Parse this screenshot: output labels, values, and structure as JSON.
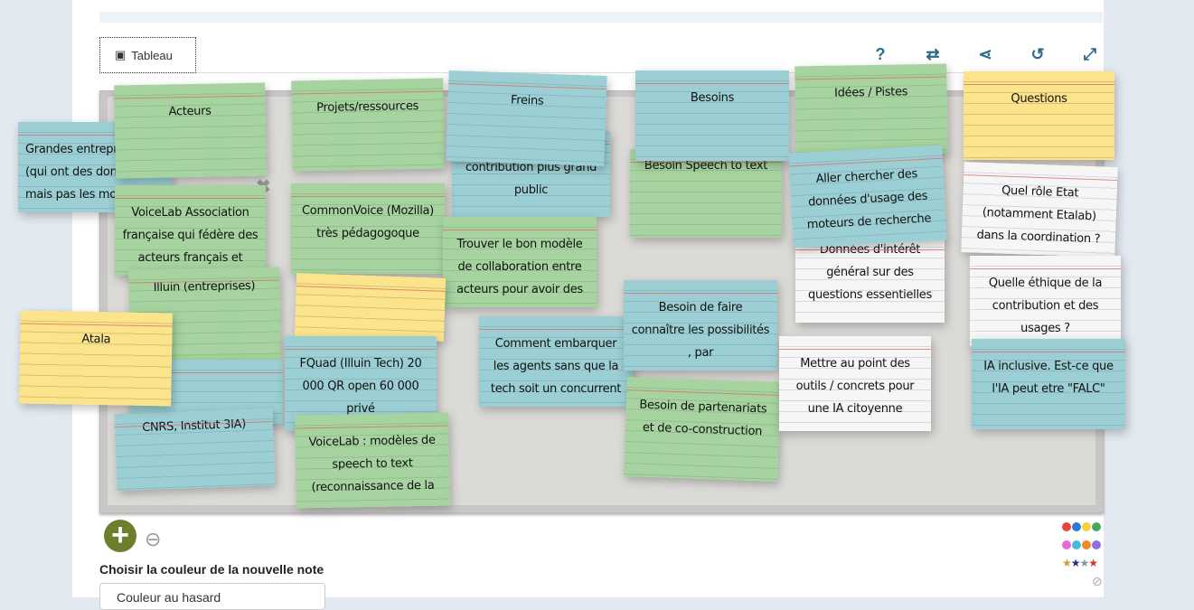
{
  "tab": {
    "label": "Tableau"
  },
  "toolbar": {
    "help": "?",
    "swap": "⇄",
    "share": "⋖",
    "history": "↺",
    "fullscreen": "⤢"
  },
  "notes": [
    {
      "text": "Grandes entreprises (qui ont des données mais pas les moyens)",
      "color": "blue"
    },
    {
      "text": "Acteurs",
      "color": "green"
    },
    {
      "text": "Projets/ressources",
      "color": "green"
    },
    {
      "text": "contribution plus grand public",
      "color": "blue"
    },
    {
      "text": "Freins",
      "color": "blue"
    },
    {
      "text": "Besoin Speech to text",
      "color": "green"
    },
    {
      "text": "Besoins",
      "color": "blue"
    },
    {
      "text": "Idées / Pistes",
      "color": "green"
    },
    {
      "text": "Questions",
      "color": "yellow"
    },
    {
      "text": "VoiceLab Association française qui fédère des acteurs français et",
      "color": "green"
    },
    {
      "text": "CommonVoice (Mozilla) très pédagogoque",
      "color": "green"
    },
    {
      "text": "Trouver le bon modèle de collaboration entre acteurs pour avoir des",
      "color": "green"
    },
    {
      "text": "Illuin (entreprises)",
      "color": "green"
    },
    {
      "text": "",
      "color": "yellow"
    },
    {
      "text": "",
      "color": "blue"
    },
    {
      "text": "CNRS, Institut 3IA)",
      "color": "blue"
    },
    {
      "text": "Atala",
      "color": "yellow"
    },
    {
      "text": "FQuad (Illuin Tech) 20 000 QR open 60 000 privé",
      "color": "blue"
    },
    {
      "text": "VoiceLab : modèles de speech to text (reconnaissance de la",
      "color": "green"
    },
    {
      "text": "Comment embarquer les agents sans que la tech soit un concurrent",
      "color": "blue"
    },
    {
      "text": "Besoin de faire connaître les possibilités , par",
      "color": "blue"
    },
    {
      "text": "Besoin de partenariats et de co-construction",
      "color": "green"
    },
    {
      "text": "Données d'intérêt général sur des questions essentielles",
      "color": "white"
    },
    {
      "text": "Aller chercher des données d'usage des moteurs de recherche",
      "color": "blue"
    },
    {
      "text": "Mettre au point des outils / concrets pour une IA citoyenne",
      "color": "white"
    },
    {
      "text": "Quel rôle Etat (notamment Etalab) dans la coordination ?",
      "color": "white"
    },
    {
      "text": "Quelle éthique de la contribution et des usages ?",
      "color": "white"
    },
    {
      "text": "IA inclusive. Est-ce que l'IA peut etre \"FALC\"",
      "color": "blue"
    }
  ],
  "footer": {
    "add": "+",
    "zoom_out": "⊖",
    "color_label": "Choisir la couleur de la nouvelle note",
    "color_select": "Couleur au hasard"
  },
  "filters": {
    "dots_row1": [
      "#e8443a",
      "#2b78d8",
      "#f7d234",
      "#45a85e"
    ],
    "dots_row2": [
      "#e46ad6",
      "#48bcd6",
      "#f0892a",
      "#8f6fe0"
    ],
    "stars": [
      "#c9a226",
      "#1d2f8f",
      "#8a96a0",
      "#d0392b"
    ],
    "none": "⊘"
  }
}
